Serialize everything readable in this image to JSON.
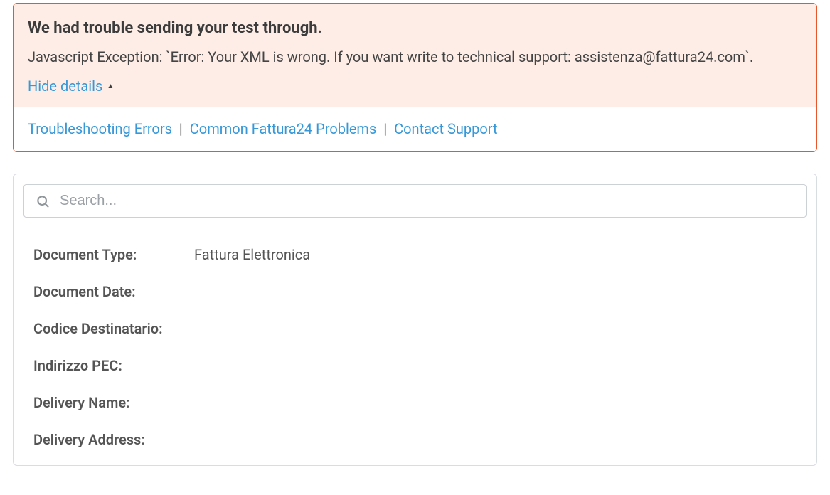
{
  "error": {
    "title": "We had trouble sending your test through.",
    "message": "Javascript Exception: `Error: Your XML is wrong. If you want write to technical support: assistenza@fattura24.com`.",
    "hide_details_label": "Hide details",
    "links": {
      "troubleshooting": "Troubleshooting Errors",
      "common_problems": "Common Fattura24 Problems",
      "contact_support": "Contact Support"
    }
  },
  "search": {
    "placeholder": "Search..."
  },
  "fields": {
    "document_type": {
      "label": "Document Type:",
      "value": "Fattura Elettronica"
    },
    "document_date": {
      "label": "Document Date:",
      "value": ""
    },
    "codice_destinatario": {
      "label": "Codice Destinatario:",
      "value": ""
    },
    "indirizzo_pec": {
      "label": "Indirizzo PEC:",
      "value": ""
    },
    "delivery_name": {
      "label": "Delivery Name:",
      "value": ""
    },
    "delivery_address": {
      "label": "Delivery Address:",
      "value": ""
    }
  }
}
